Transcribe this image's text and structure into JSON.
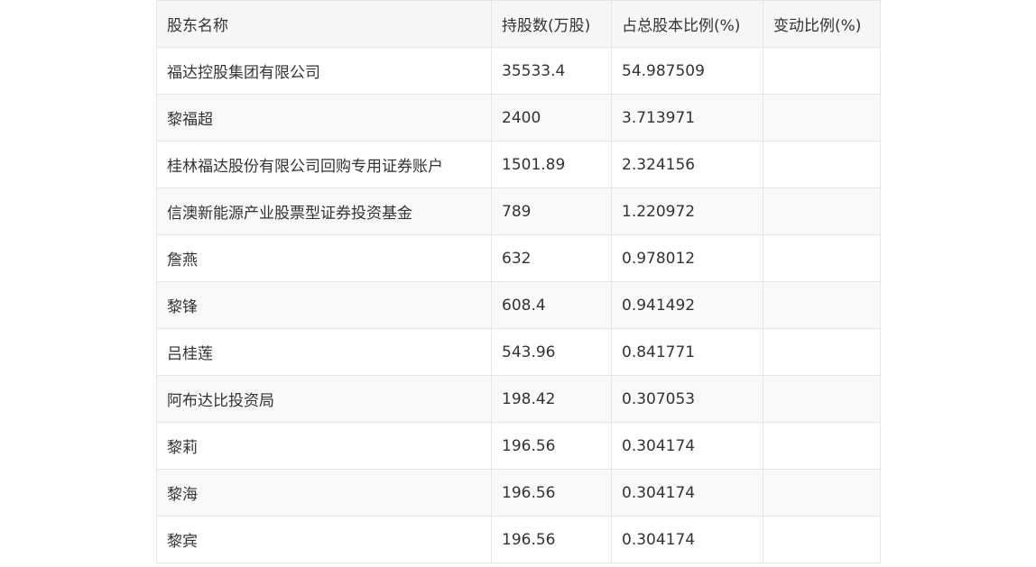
{
  "table": {
    "headers": [
      "股东名称",
      "持股数(万股)",
      "占总股本比例(%)",
      "变动比例(%)"
    ],
    "rows": [
      [
        "福达控股集团有限公司",
        "35533.4",
        "54.987509",
        ""
      ],
      [
        "黎福超",
        "2400",
        "3.713971",
        ""
      ],
      [
        "桂林福达股份有限公司回购专用证券账户",
        "1501.89",
        "2.324156",
        ""
      ],
      [
        "信澳新能源产业股票型证券投资基金",
        "789",
        "1.220972",
        ""
      ],
      [
        "詹燕",
        "632",
        "0.978012",
        ""
      ],
      [
        "黎锋",
        "608.4",
        "0.941492",
        ""
      ],
      [
        "吕桂莲",
        "543.96",
        "0.841771",
        ""
      ],
      [
        "阿布达比投资局",
        "198.42",
        "0.307053",
        ""
      ],
      [
        "黎莉",
        "196.56",
        "0.304174",
        ""
      ],
      [
        "黎海",
        "196.56",
        "0.304174",
        ""
      ],
      [
        "黎宾",
        "196.56",
        "0.304174",
        ""
      ]
    ]
  }
}
